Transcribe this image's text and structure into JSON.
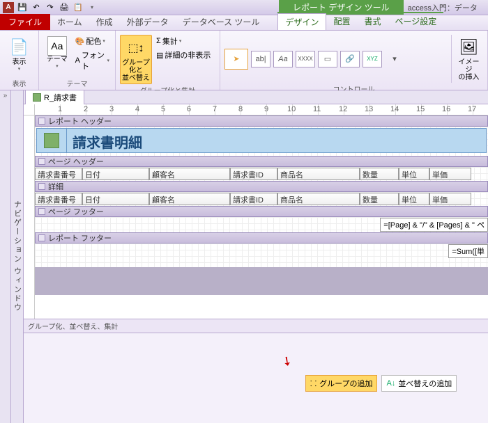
{
  "app": {
    "access_icon": "A",
    "context_tool": "レポート デザイン ツール",
    "title": "access入門：データ"
  },
  "tabs": {
    "file": "ファイル",
    "home": "ホーム",
    "create": "作成",
    "external": "外部データ",
    "dbtools": "データベース ツール",
    "design": "デザイン",
    "arrange": "配置",
    "format": "書式",
    "pagesetup": "ページ設定"
  },
  "ribbon": {
    "view": {
      "label": "表示",
      "btn": "表示"
    },
    "theme": {
      "label": "テーマ",
      "btn": "テーマ",
      "colors": "配色",
      "fonts": "フォント"
    },
    "grouping": {
      "label": "グループ化と集計",
      "sort": "グループ化と\n並べ替え",
      "totals": "集計",
      "hide": "詳細の非表示"
    },
    "controls": {
      "label": "コントロール",
      "insert_image": "イメージ\nの挿入"
    }
  },
  "nav": {
    "label": "ナビゲーション ウィンドウ"
  },
  "doc": {
    "tab": "R_請求書"
  },
  "sections": {
    "report_header": "レポート ヘッダー",
    "page_header": "ページ ヘッダー",
    "detail": "詳細",
    "page_footer": "ページ フッター",
    "report_footer": "レポート フッター",
    "title": "請求書明細"
  },
  "fields": {
    "c1": "請求書番号",
    "c2": "日付",
    "c3": "顧客名",
    "c4": "請求書ID",
    "c5": "商品名",
    "c6": "数量",
    "c7": "単位",
    "c8": "単価"
  },
  "exprs": {
    "page": "=[Page] & \"/\" & [Pages] & \" ペ",
    "sum": "=Sum([単"
  },
  "group_panel": {
    "title": "グループ化、並べ替え、集計",
    "add_group": "グループの追加",
    "add_sort": "並べ替えの追加"
  }
}
